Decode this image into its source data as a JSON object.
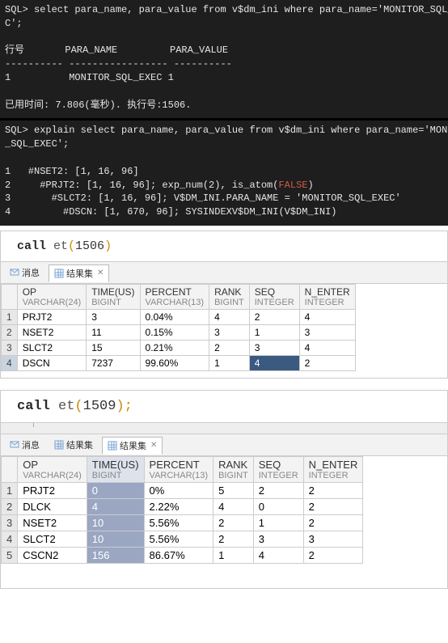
{
  "terminal1": {
    "line1": "SQL> select para_name, para_value from v$dm_ini where para_name='MONITOR_SQL_EXE",
    "line2": "C';",
    "blank": "",
    "hdr": "行号       PARA_NAME         PARA_VALUE",
    "sep": "---------- ----------------- ----------",
    "row": "1          MONITOR_SQL_EXEC 1",
    "footer": "已用时间: 7.806(毫秒). 执行号:1506."
  },
  "terminal2": {
    "line1": "SQL> explain select para_name, para_value from v$dm_ini where para_name='MONITOR",
    "line2": "_SQL_EXEC';",
    "blank": "",
    "p1": "1   #NSET2: [1, 16, 96]",
    "p2a": "2     #PRJT2: [1, 16, 96]; exp_num(2), is_atom(",
    "p2b": "FALSE",
    "p2c": ")",
    "p3": "3       #SLCT2: [1, 16, 96]; V$DM_INI.PARA_NAME = 'MONITOR_SQL_EXEC'",
    "p4": "4         #DSCN: [1, 670, 96]; SYSINDEXV$DM_INI(V$DM_INI)"
  },
  "gui1": {
    "editor": {
      "kw": "call",
      "fn": " et",
      "open": "(",
      "arg": "1506",
      "close": ")"
    },
    "tabs": {
      "msg": "消息",
      "rs": "结果集"
    },
    "columns": [
      {
        "name": "OP",
        "type": "VARCHAR(24)"
      },
      {
        "name": "TIME(US)",
        "type": "BIGINT"
      },
      {
        "name": "PERCENT",
        "type": "VARCHAR(13)"
      },
      {
        "name": "RANK",
        "type": "BIGINT"
      },
      {
        "name": "SEQ",
        "type": "INTEGER"
      },
      {
        "name": "N_ENTER",
        "type": "INTEGER"
      }
    ],
    "rows": [
      {
        "n": "1",
        "op": "PRJT2",
        "time": "3",
        "pct": "0.04%",
        "rank": "4",
        "seq": "2",
        "nent": "4"
      },
      {
        "n": "2",
        "op": "NSET2",
        "time": "11",
        "pct": "0.15%",
        "rank": "3",
        "seq": "1",
        "nent": "3"
      },
      {
        "n": "3",
        "op": "SLCT2",
        "time": "15",
        "pct": "0.21%",
        "rank": "2",
        "seq": "3",
        "nent": "4"
      },
      {
        "n": "4",
        "op": "DSCN",
        "time": "7237",
        "pct": "99.60%",
        "rank": "1",
        "seq": "4",
        "nent": "2"
      }
    ],
    "selected_row_index": 3,
    "selected_cell_col": "seq"
  },
  "gui2": {
    "editor": {
      "kw": "call",
      "fn": " et",
      "open": "(",
      "arg": "1509",
      "close": ");"
    },
    "tabs": {
      "msg": "消息",
      "rs": "结果集",
      "rs2": "结果集"
    },
    "columns": [
      {
        "name": "OP",
        "type": "VARCHAR(24)"
      },
      {
        "name": "TIME(US)",
        "type": "BIGINT"
      },
      {
        "name": "PERCENT",
        "type": "VARCHAR(13)"
      },
      {
        "name": "RANK",
        "type": "BIGINT"
      },
      {
        "name": "SEQ",
        "type": "INTEGER"
      },
      {
        "name": "N_ENTER",
        "type": "INTEGER"
      }
    ],
    "rows": [
      {
        "n": "1",
        "op": "PRJT2",
        "time": "0",
        "pct": "0%",
        "rank": "5",
        "seq": "2",
        "nent": "2"
      },
      {
        "n": "2",
        "op": "DLCK",
        "time": "4",
        "pct": "2.22%",
        "rank": "4",
        "seq": "0",
        "nent": "2"
      },
      {
        "n": "3",
        "op": "NSET2",
        "time": "10",
        "pct": "5.56%",
        "rank": "2",
        "seq": "1",
        "nent": "2"
      },
      {
        "n": "4",
        "op": "SLCT2",
        "time": "10",
        "pct": "5.56%",
        "rank": "2",
        "seq": "3",
        "nent": "3"
      },
      {
        "n": "5",
        "op": "CSCN2",
        "time": "156",
        "pct": "86.67%",
        "rank": "1",
        "seq": "4",
        "nent": "2"
      }
    ]
  }
}
